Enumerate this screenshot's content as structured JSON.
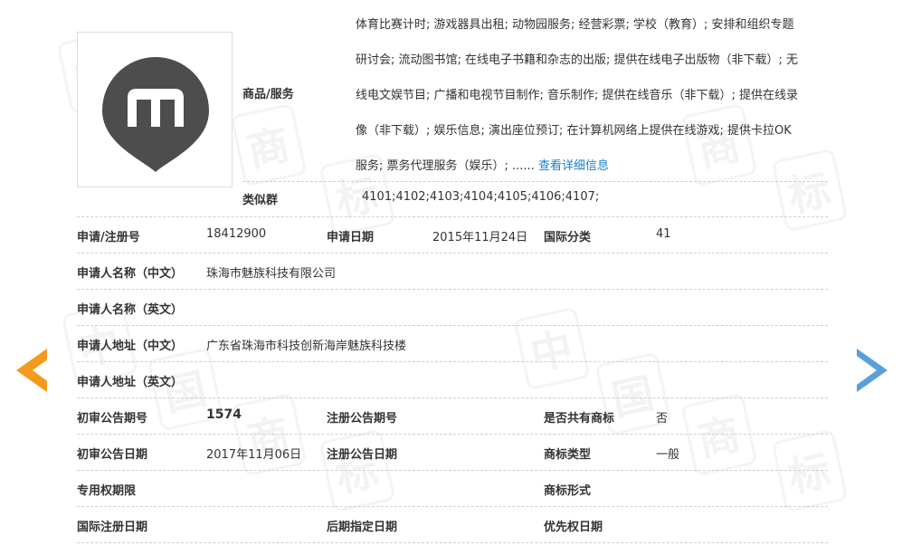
{
  "goods": {
    "label": "商品/服务",
    "lines": [
      "体育比赛计时; 游戏器具出租; 动物园服务; 经营彩票; 学校（教育）; 安排和组织专题",
      "研讨会; 流动图书馆; 在线电子书籍和杂志的出版; 提供在线电子出版物（非下载）; 无",
      "线电文娱节目; 广播和电视节目制作; 音乐制作; 提供在线音乐（非下载）; 提供在线录",
      "像（非下载）; 娱乐信息; 演出座位预订; 在计算机网络上提供在线游戏; 提供卡拉OK",
      "服务; 票务代理服务（娱乐）; ......"
    ],
    "more_link": "查看详细信息"
  },
  "similar_group": {
    "label": "类似群",
    "value": "4101;4102;4103;4104;4105;4106;4107;"
  },
  "details": {
    "reg_no_label": "申请/注册号",
    "reg_no": "18412900",
    "apply_date_label": "申请日期",
    "apply_date": "2015年11月24日",
    "intl_class_label": "国际分类",
    "intl_class": "41",
    "applicant_cn_label": "申请人名称（中文）",
    "applicant_cn": "珠海市魅族科技有限公司",
    "applicant_en_label": "申请人名称（英文）",
    "applicant_en": "",
    "address_cn_label": "申请人地址（中文）",
    "address_cn": "广东省珠海市科技创新海岸魅族科技楼",
    "address_en_label": "申请人地址（英文）",
    "address_en": "",
    "prelim_issue_label": "初审公告期号",
    "prelim_issue": "1574",
    "reg_issue_label": "注册公告期号",
    "reg_issue": "",
    "shared_label": "是否共有商标",
    "shared": "否",
    "prelim_date_label": "初审公告日期",
    "prelim_date": "2017年11月06日",
    "reg_date_label": "注册公告日期",
    "reg_date": "",
    "mark_type_label": "商标类型",
    "mark_type": "一般",
    "exclusive_label": "专用权期限",
    "exclusive": "",
    "mark_form_label": "商标形式",
    "mark_form": "",
    "intl_reg_date_label": "国际注册日期",
    "intl_reg_date": "",
    "later_date_label": "后期指定日期",
    "later_date": "",
    "priority_date_label": "优先权日期",
    "priority_date": ""
  },
  "watermark": [
    "中",
    "国",
    "商",
    "标"
  ],
  "colors": {
    "link": "#1a7fc8",
    "prev_arrow": "#f39a1e",
    "next_arrow": "#5aa0d8",
    "logo": "#4d4d4d"
  },
  "icons": {
    "logo": "meizu-m-pin-logo",
    "prev": "arrow-left-icon",
    "next": "arrow-right-icon"
  }
}
